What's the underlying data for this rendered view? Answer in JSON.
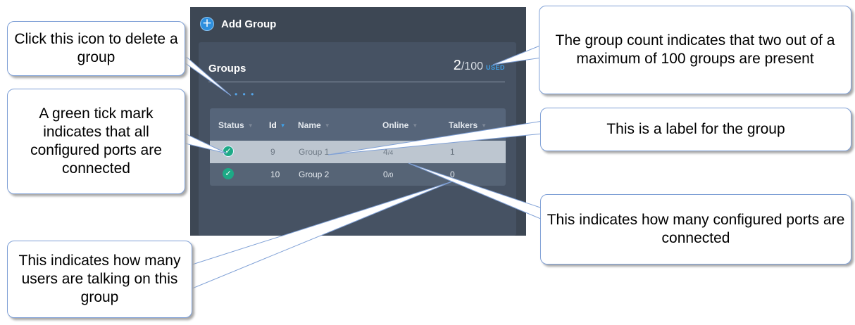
{
  "app": {
    "add_group_label": "Add Group",
    "card_title": "Groups",
    "count_used": "2",
    "count_max": "/100",
    "count_tag": "USED",
    "columns": [
      {
        "label": "Status",
        "sorted": false
      },
      {
        "label": "Id",
        "sorted": true
      },
      {
        "label": "Name",
        "sorted": false
      },
      {
        "label": "Online",
        "sorted": false
      },
      {
        "label": "Talkers",
        "sorted": false
      }
    ],
    "rows": [
      {
        "id": "9",
        "name": "Group 1",
        "online": "4",
        "online_total": "/4",
        "talkers": "1",
        "selected": true
      },
      {
        "id": "10",
        "name": "Group 2",
        "online": "0",
        "online_total": "/0",
        "talkers": "0",
        "selected": false
      }
    ],
    "colors": {
      "background": "#3d4754",
      "card": "#465263",
      "accent": "#2d8fde",
      "ok_green": "#1daa86"
    }
  },
  "callouts": {
    "delete": "Click this icon to delete a group",
    "count": "The group count indicates that two out of a maximum of 100 groups are present",
    "tick": "A green tick mark indicates that all configured ports are connected",
    "label": "This is a label for the group",
    "ports": "This indicates how many configured ports are connected",
    "talkers": "This indicates how many users are talking on this group"
  }
}
